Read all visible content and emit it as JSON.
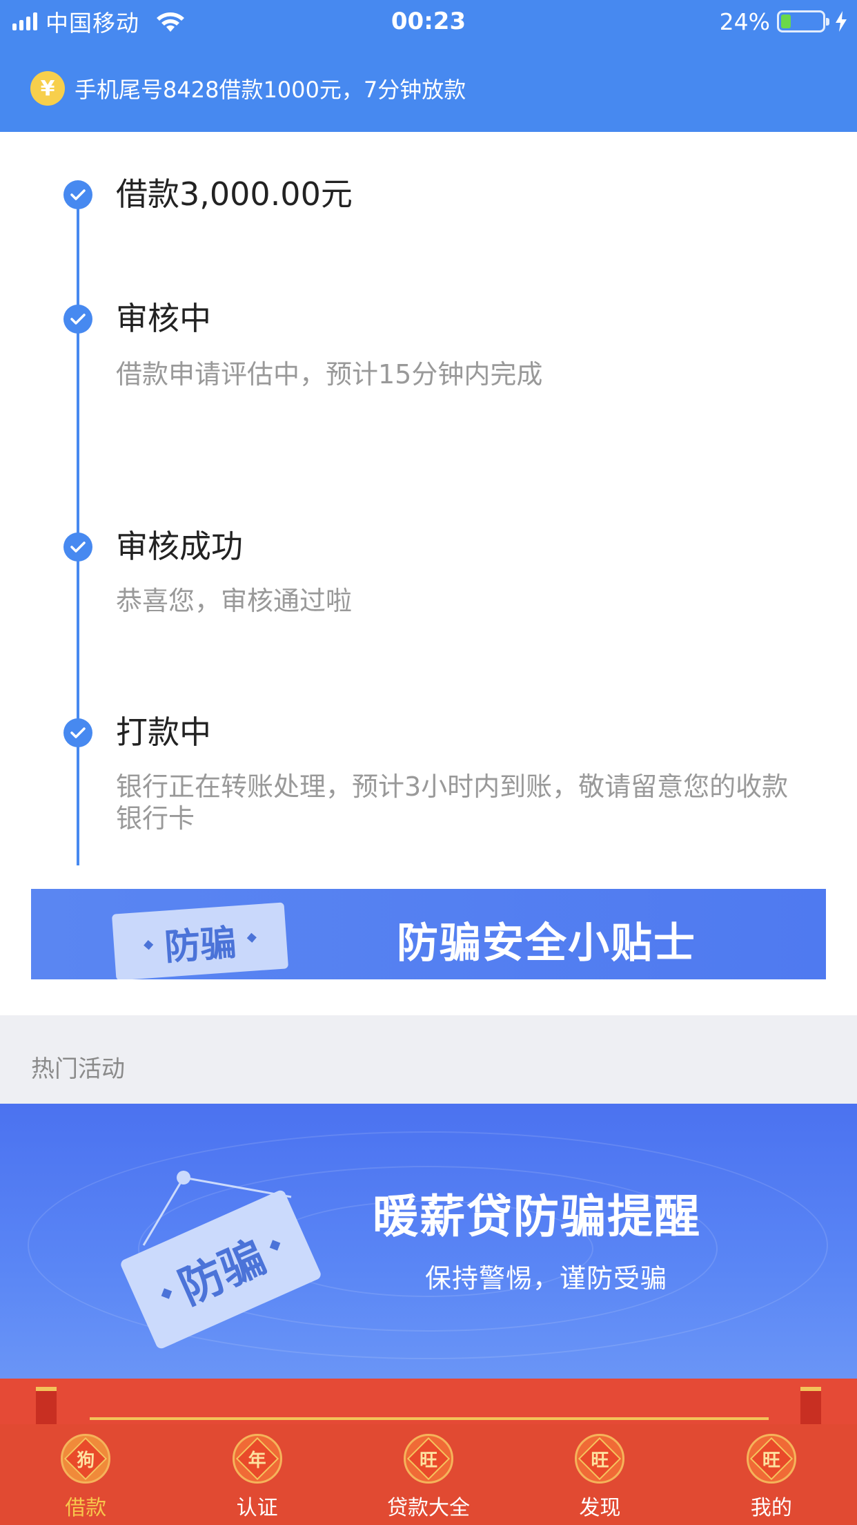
{
  "status_bar": {
    "carrier": "中国移动",
    "time": "00:23",
    "battery": "24%",
    "battery_level": 0.24
  },
  "notice": {
    "icon": "yen-icon",
    "icon_glyph": "¥",
    "text": "手机尾号8428借款1000元，7分钟放款"
  },
  "timeline": {
    "steps": [
      {
        "title": "借款3,000.00元",
        "desc": ""
      },
      {
        "title": "审核中",
        "desc": "借款申请评估中，预计15分钟内完成"
      },
      {
        "title": "审核成功",
        "desc": "恭喜您，审核通过啦"
      },
      {
        "title": "打款中",
        "desc": "银行正在转账处理，预计3小时内到账，敬请留意您的收款银行卡"
      }
    ]
  },
  "tips_banner": {
    "tag": "防骗",
    "title": "防骗安全小贴士"
  },
  "hot_section": {
    "title": "热门活动"
  },
  "activity_banner": {
    "tag": "防骗",
    "title": "暖薪贷防骗提醒",
    "subtitle": "保持警惕，谨防受骗"
  },
  "tabbar": {
    "active_index": 0,
    "items": [
      {
        "label": "借款",
        "glyph": "狗",
        "icon": "dog-lantern-icon"
      },
      {
        "label": "认证",
        "glyph": "年",
        "icon": "nian-icon"
      },
      {
        "label": "贷款大全",
        "glyph": "旺",
        "icon": "wang-icon"
      },
      {
        "label": "发现",
        "glyph": "旺",
        "icon": "wang-icon"
      },
      {
        "label": "我的",
        "glyph": "旺",
        "icon": "wang-icon"
      }
    ]
  },
  "colors": {
    "primary": "#4789f0",
    "tabbar": "#e14a32",
    "active_tab": "#f7c64c"
  }
}
